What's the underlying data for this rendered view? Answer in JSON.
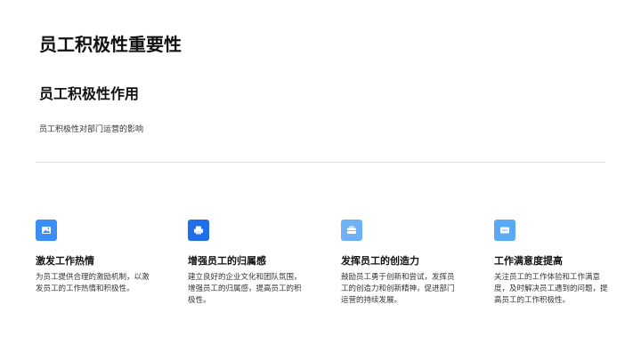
{
  "slide": {
    "title": "员工积极性重要性",
    "subtitle": "员工积极性作用",
    "description": "员工积极性对部门运营的影响"
  },
  "cards": [
    {
      "icon": "image-icon",
      "color": "#3a8ef6",
      "title": "激发工作热情",
      "text": "为员工提供合理的激励机制，以激发员工的工作热情和积极性。"
    },
    {
      "icon": "printer-icon",
      "color": "#1f6fe8",
      "title": "增强员工的归属感",
      "text": "建立良好的企业文化和团队氛围，增强员工的归属感，提高员工的积极性。"
    },
    {
      "icon": "briefcase-icon",
      "color": "#6fb1f7",
      "title": "发挥员工的创造力",
      "text": "鼓励员工勇于创新和尝试，发挥员工的创造力和创新精神，促进部门运营的持续发展。"
    },
    {
      "icon": "message-icon",
      "color": "#5aa9f4",
      "title": "工作满意度提高",
      "text": "关注员工的工作体验和工作满意度，及时解决员工遇到的问题，提高员工的工作积极性。"
    }
  ]
}
